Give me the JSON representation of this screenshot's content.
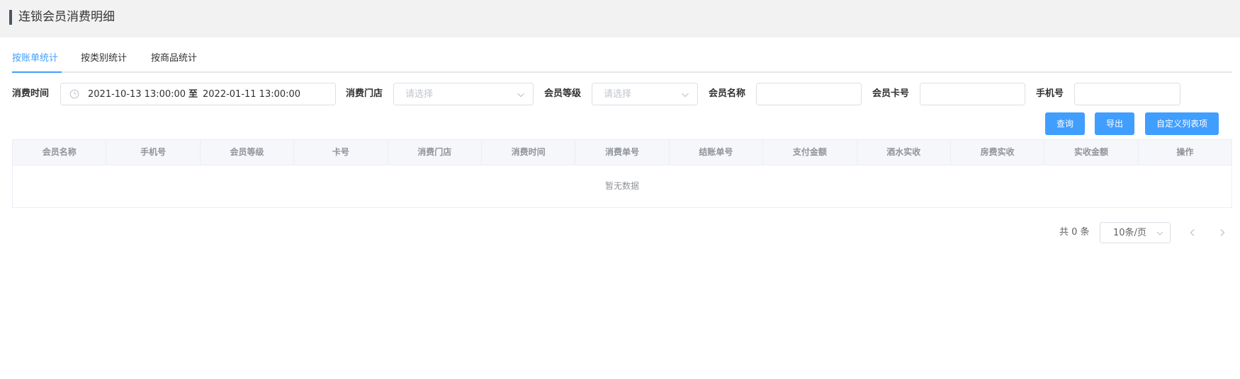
{
  "header": {
    "title": "连锁会员消费明细"
  },
  "tabs": [
    {
      "label": "按账单统计",
      "active": true
    },
    {
      "label": "按类别统计",
      "active": false
    },
    {
      "label": "按商品统计",
      "active": false
    }
  ],
  "filters": {
    "time_label": "消费时间",
    "time_start": "2021-10-13 13:00:00",
    "time_separator": "至",
    "time_end": "2022-01-11 13:00:00",
    "store_label": "消费门店",
    "store_placeholder": "请选择",
    "level_label": "会员等级",
    "level_placeholder": "请选择",
    "name_label": "会员名称",
    "name_value": "",
    "card_label": "会员卡号",
    "card_value": "",
    "phone_label": "手机号",
    "phone_value": ""
  },
  "buttons": {
    "query": "查询",
    "export": "导出",
    "custom_columns": "自定义列表项"
  },
  "table": {
    "columns": [
      "会员名称",
      "手机号",
      "会员等级",
      "卡号",
      "消费门店",
      "消费时间",
      "消费单号",
      "结账单号",
      "支付金额",
      "酒水实收",
      "房费实收",
      "实收金额",
      "操作"
    ],
    "empty_text": "暂无数据"
  },
  "pagination": {
    "total_text": "共 0 条",
    "page_size": "10条/页"
  },
  "colors": {
    "accent": "#409eff",
    "header_bg": "#f2f2f2",
    "border": "#dcdfe6"
  }
}
